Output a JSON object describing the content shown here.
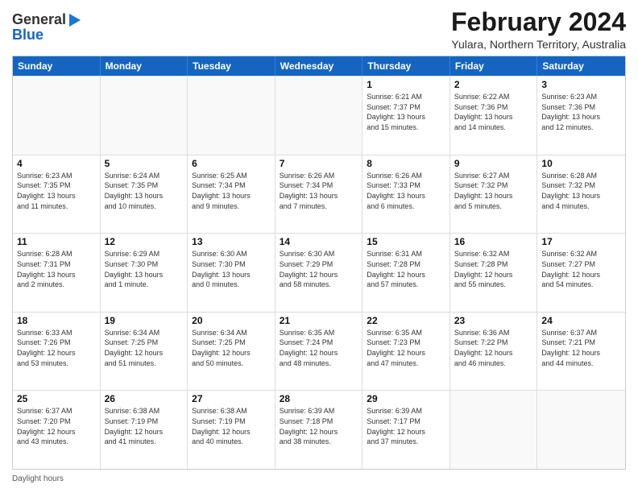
{
  "logo": {
    "line1": "General",
    "line2": "Blue"
  },
  "title": "February 2024",
  "subtitle": "Yulara, Northern Territory, Australia",
  "days_of_week": [
    "Sunday",
    "Monday",
    "Tuesday",
    "Wednesday",
    "Thursday",
    "Friday",
    "Saturday"
  ],
  "footer": "Daylight hours",
  "weeks": [
    [
      {
        "num": "",
        "lines": []
      },
      {
        "num": "",
        "lines": []
      },
      {
        "num": "",
        "lines": []
      },
      {
        "num": "",
        "lines": []
      },
      {
        "num": "1",
        "lines": [
          "Sunrise: 6:21 AM",
          "Sunset: 7:37 PM",
          "Daylight: 13 hours",
          "and 15 minutes."
        ]
      },
      {
        "num": "2",
        "lines": [
          "Sunrise: 6:22 AM",
          "Sunset: 7:36 PM",
          "Daylight: 13 hours",
          "and 14 minutes."
        ]
      },
      {
        "num": "3",
        "lines": [
          "Sunrise: 6:23 AM",
          "Sunset: 7:36 PM",
          "Daylight: 13 hours",
          "and 12 minutes."
        ]
      }
    ],
    [
      {
        "num": "4",
        "lines": [
          "Sunrise: 6:23 AM",
          "Sunset: 7:35 PM",
          "Daylight: 13 hours",
          "and 11 minutes."
        ]
      },
      {
        "num": "5",
        "lines": [
          "Sunrise: 6:24 AM",
          "Sunset: 7:35 PM",
          "Daylight: 13 hours",
          "and 10 minutes."
        ]
      },
      {
        "num": "6",
        "lines": [
          "Sunrise: 6:25 AM",
          "Sunset: 7:34 PM",
          "Daylight: 13 hours",
          "and 9 minutes."
        ]
      },
      {
        "num": "7",
        "lines": [
          "Sunrise: 6:26 AM",
          "Sunset: 7:34 PM",
          "Daylight: 13 hours",
          "and 7 minutes."
        ]
      },
      {
        "num": "8",
        "lines": [
          "Sunrise: 6:26 AM",
          "Sunset: 7:33 PM",
          "Daylight: 13 hours",
          "and 6 minutes."
        ]
      },
      {
        "num": "9",
        "lines": [
          "Sunrise: 6:27 AM",
          "Sunset: 7:32 PM",
          "Daylight: 13 hours",
          "and 5 minutes."
        ]
      },
      {
        "num": "10",
        "lines": [
          "Sunrise: 6:28 AM",
          "Sunset: 7:32 PM",
          "Daylight: 13 hours",
          "and 4 minutes."
        ]
      }
    ],
    [
      {
        "num": "11",
        "lines": [
          "Sunrise: 6:28 AM",
          "Sunset: 7:31 PM",
          "Daylight: 13 hours",
          "and 2 minutes."
        ]
      },
      {
        "num": "12",
        "lines": [
          "Sunrise: 6:29 AM",
          "Sunset: 7:30 PM",
          "Daylight: 13 hours",
          "and 1 minute."
        ]
      },
      {
        "num": "13",
        "lines": [
          "Sunrise: 6:30 AM",
          "Sunset: 7:30 PM",
          "Daylight: 13 hours",
          "and 0 minutes."
        ]
      },
      {
        "num": "14",
        "lines": [
          "Sunrise: 6:30 AM",
          "Sunset: 7:29 PM",
          "Daylight: 12 hours",
          "and 58 minutes."
        ]
      },
      {
        "num": "15",
        "lines": [
          "Sunrise: 6:31 AM",
          "Sunset: 7:28 PM",
          "Daylight: 12 hours",
          "and 57 minutes."
        ]
      },
      {
        "num": "16",
        "lines": [
          "Sunrise: 6:32 AM",
          "Sunset: 7:28 PM",
          "Daylight: 12 hours",
          "and 55 minutes."
        ]
      },
      {
        "num": "17",
        "lines": [
          "Sunrise: 6:32 AM",
          "Sunset: 7:27 PM",
          "Daylight: 12 hours",
          "and 54 minutes."
        ]
      }
    ],
    [
      {
        "num": "18",
        "lines": [
          "Sunrise: 6:33 AM",
          "Sunset: 7:26 PM",
          "Daylight: 12 hours",
          "and 53 minutes."
        ]
      },
      {
        "num": "19",
        "lines": [
          "Sunrise: 6:34 AM",
          "Sunset: 7:25 PM",
          "Daylight: 12 hours",
          "and 51 minutes."
        ]
      },
      {
        "num": "20",
        "lines": [
          "Sunrise: 6:34 AM",
          "Sunset: 7:25 PM",
          "Daylight: 12 hours",
          "and 50 minutes."
        ]
      },
      {
        "num": "21",
        "lines": [
          "Sunrise: 6:35 AM",
          "Sunset: 7:24 PM",
          "Daylight: 12 hours",
          "and 48 minutes."
        ]
      },
      {
        "num": "22",
        "lines": [
          "Sunrise: 6:35 AM",
          "Sunset: 7:23 PM",
          "Daylight: 12 hours",
          "and 47 minutes."
        ]
      },
      {
        "num": "23",
        "lines": [
          "Sunrise: 6:36 AM",
          "Sunset: 7:22 PM",
          "Daylight: 12 hours",
          "and 46 minutes."
        ]
      },
      {
        "num": "24",
        "lines": [
          "Sunrise: 6:37 AM",
          "Sunset: 7:21 PM",
          "Daylight: 12 hours",
          "and 44 minutes."
        ]
      }
    ],
    [
      {
        "num": "25",
        "lines": [
          "Sunrise: 6:37 AM",
          "Sunset: 7:20 PM",
          "Daylight: 12 hours",
          "and 43 minutes."
        ]
      },
      {
        "num": "26",
        "lines": [
          "Sunrise: 6:38 AM",
          "Sunset: 7:19 PM",
          "Daylight: 12 hours",
          "and 41 minutes."
        ]
      },
      {
        "num": "27",
        "lines": [
          "Sunrise: 6:38 AM",
          "Sunset: 7:19 PM",
          "Daylight: 12 hours",
          "and 40 minutes."
        ]
      },
      {
        "num": "28",
        "lines": [
          "Sunrise: 6:39 AM",
          "Sunset: 7:18 PM",
          "Daylight: 12 hours",
          "and 38 minutes."
        ]
      },
      {
        "num": "29",
        "lines": [
          "Sunrise: 6:39 AM",
          "Sunset: 7:17 PM",
          "Daylight: 12 hours",
          "and 37 minutes."
        ]
      },
      {
        "num": "",
        "lines": []
      },
      {
        "num": "",
        "lines": []
      }
    ]
  ]
}
